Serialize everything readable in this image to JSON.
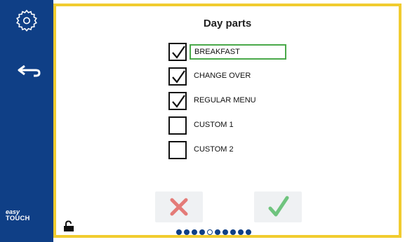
{
  "sidebar": {
    "settings_icon": "gear-icon",
    "back_icon": "back-arrow-icon",
    "brand_line1": "easy",
    "brand_line2": "TOUCH"
  },
  "screen": {
    "title": "Day parts",
    "items": [
      {
        "label": "BREAKFAST",
        "checked": true,
        "selected": true
      },
      {
        "label": "CHANGE OVER",
        "checked": true,
        "selected": false
      },
      {
        "label": "REGULAR MENU",
        "checked": true,
        "selected": false
      },
      {
        "label": "CUSTOM 1",
        "checked": false,
        "selected": false
      },
      {
        "label": "CUSTOM 2",
        "checked": false,
        "selected": false
      }
    ]
  },
  "actions": {
    "cancel_icon": "cancel-x-icon",
    "confirm_icon": "confirm-check-icon"
  },
  "footer": {
    "lock_icon": "unlocked-padlock-icon",
    "pager": {
      "pages": 10,
      "current": 5
    }
  },
  "colors": {
    "sidebar": "#0f3f86",
    "frame": "#f1cc2f",
    "selection": "#4aa94a",
    "cancel": "#e47b78",
    "confirm": "#6fc47e"
  }
}
